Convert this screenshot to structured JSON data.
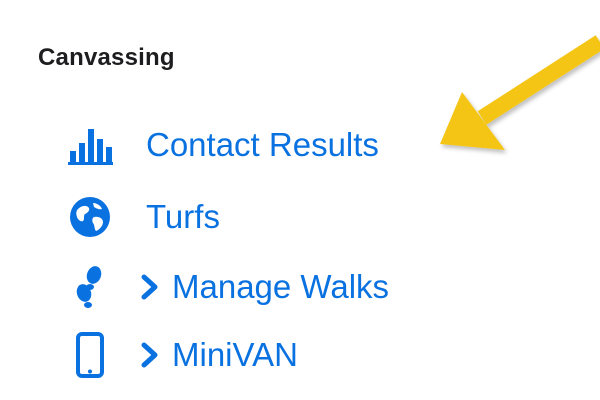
{
  "section": {
    "title": "Canvassing"
  },
  "menu": {
    "items": [
      {
        "label": "Contact Results",
        "icon": "bar-chart-icon",
        "expandable": false
      },
      {
        "label": "Turfs",
        "icon": "globe-icon",
        "expandable": false
      },
      {
        "label": "Manage Walks",
        "icon": "footprints-icon",
        "expandable": true
      },
      {
        "label": "MiniVAN",
        "icon": "mobile-phone-icon",
        "expandable": true
      }
    ]
  },
  "colors": {
    "link": "#0a72e0",
    "heading": "#1d1d1f",
    "annotation_arrow": "#f5c518"
  }
}
